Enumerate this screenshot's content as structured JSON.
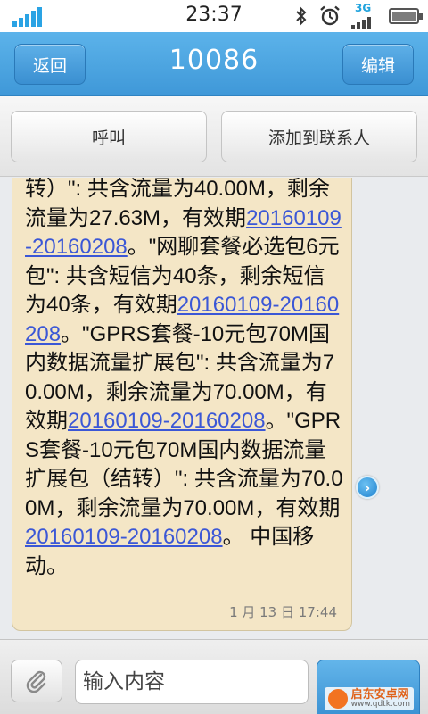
{
  "status_bar": {
    "time": "23:37",
    "network_label": "3G",
    "icons": [
      "signal-icon",
      "bluetooth-icon",
      "alarm-icon",
      "network-3g-icon",
      "battery-icon"
    ]
  },
  "header": {
    "title": "10086",
    "back_label": "返回",
    "edit_label": "编辑"
  },
  "actions": {
    "call_label": "呼叫",
    "add_contact_label": "添加到联系人"
  },
  "message": {
    "segments": [
      {
        "text": "转）\": 共含流量为40.00M，剩余流量为27.63M，有效期",
        "link": false
      },
      {
        "text": "20160109-20160208",
        "link": true
      },
      {
        "text": "。\"网聊套餐必选包6元包\": 共含短信为40条，剩余短信为40条，有效期",
        "link": false
      },
      {
        "text": "20160109-20160208",
        "link": true
      },
      {
        "text": "。\"GPRS套餐-10元包70M国内数据流量扩展包\": 共含流量为70.00M，剩余流量为70.00M，有效期",
        "link": false
      },
      {
        "text": "20160109-20160208",
        "link": true
      },
      {
        "text": "。\"GPRS套餐-10元包70M国内数据流量扩展包（结转）\": 共含流量为70.00M，剩余流量为70.00M，有效期",
        "link": false
      },
      {
        "text": "20160109-20160208",
        "link": true
      },
      {
        "text": "。 中国移动。",
        "link": false
      }
    ],
    "time": "1 月 13 日 17:44"
  },
  "input": {
    "placeholder": "输入内容",
    "value": ""
  },
  "watermark": {
    "name": "启东安卓网",
    "url": "www.qdtk.com"
  },
  "colors": {
    "header_blue": "#4aa3e0",
    "bubble_bg": "#f4e6c6",
    "link_color": "#3b57d6",
    "signal_blue": "#2aa3e4"
  }
}
